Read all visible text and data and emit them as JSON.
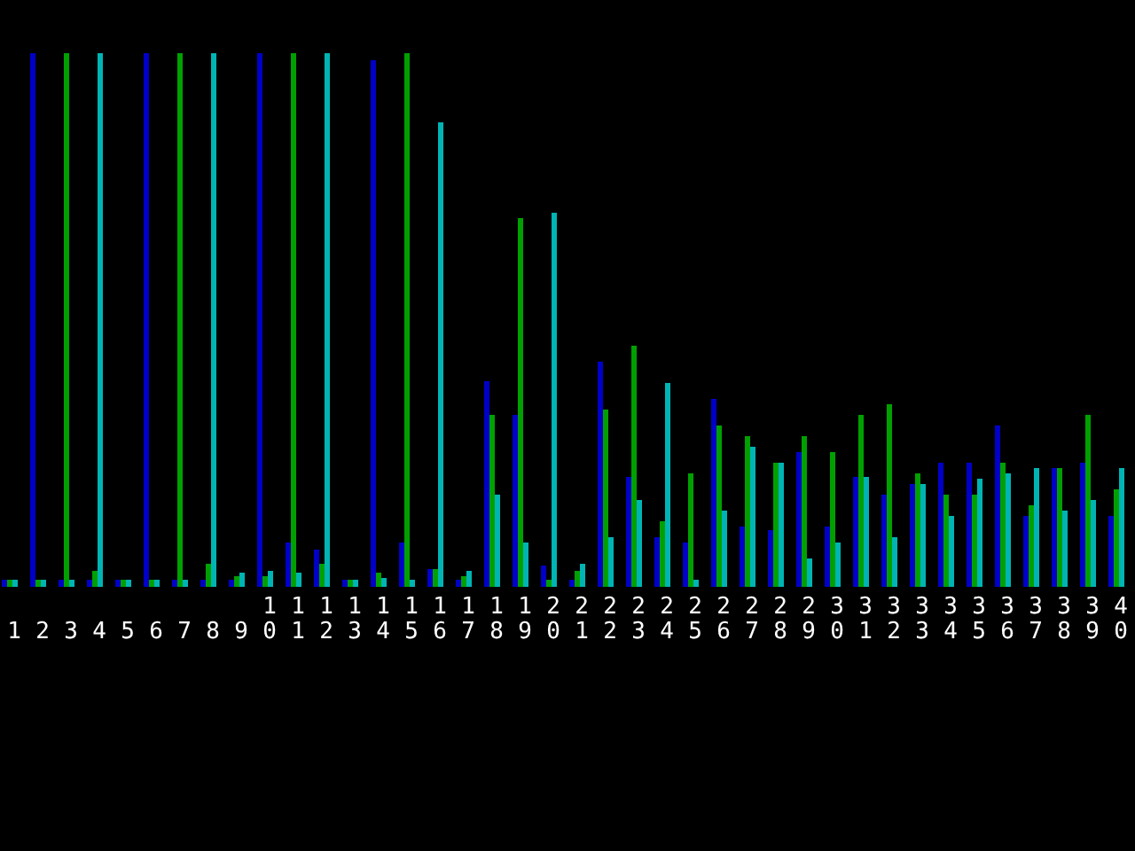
{
  "chart": {
    "series": [
      {
        "color": "#0000c8"
      },
      {
        "color": "#00a000"
      },
      {
        "color": "#00b4b4"
      }
    ],
    "x_labels": [
      "1",
      "2",
      "3",
      "4",
      "5",
      "6",
      "7",
      "8",
      "9",
      "10",
      "11",
      "12",
      "13",
      "14",
      "15",
      "16",
      "17",
      "18",
      "19",
      "20",
      "21",
      "22",
      "23",
      "24",
      "25",
      "26",
      "27",
      "28",
      "29",
      "30",
      "31",
      "32",
      "33",
      "34",
      "35",
      "36",
      "37",
      "38",
      "39",
      "40"
    ]
  }
}
